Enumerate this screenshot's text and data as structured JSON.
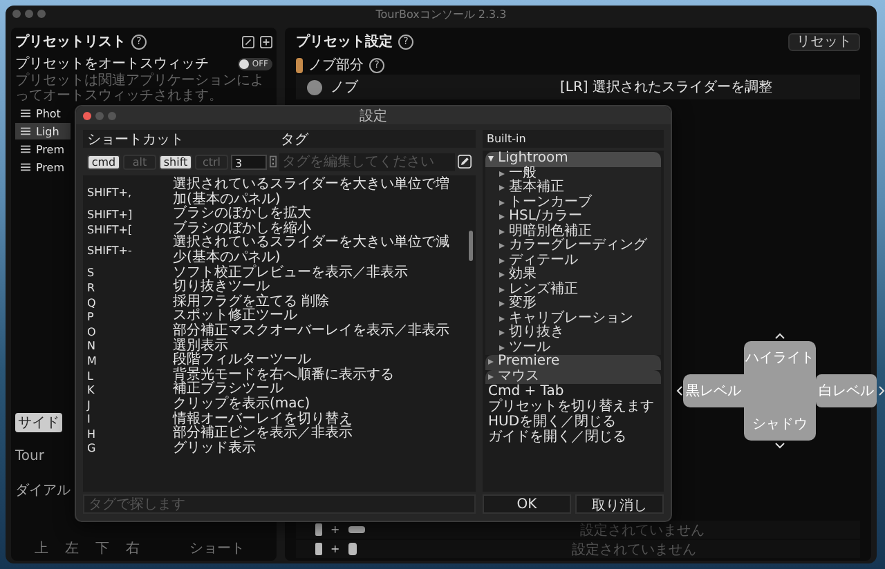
{
  "window": {
    "title": "TourBoxコンソール 2.3.3"
  },
  "preset_list": {
    "title": "プリセットリスト",
    "help": "?",
    "autoswitch": {
      "label": "プリセットをオートスウィッチ",
      "toggle": "OFF",
      "on": false
    },
    "description": "プリセットは関連アプリケーションによってオートスウィッチされます。",
    "items": [
      {
        "label": "Phot",
        "selected": false
      },
      {
        "label": "Ligh",
        "selected": true
      },
      {
        "label": "Prem",
        "selected": false
      },
      {
        "label": "Prem",
        "selected": false
      }
    ]
  },
  "controller": {
    "side_badge": "サイド",
    "labels": [
      "Tour",
      "ダイアル"
    ],
    "short_label": "ショート",
    "directions": [
      "上",
      "左",
      "下",
      "右"
    ]
  },
  "preset_settings": {
    "title": "プリセット設定",
    "help": "?",
    "reset": "リセット",
    "section": "ノブ部分",
    "section_help": "?",
    "knob": {
      "label": "ノブ",
      "action": "[LR] 選択されたスライダーを調整"
    },
    "rows": [
      {
        "kind": "plus_bar",
        "count": "+",
        "action": "設定されていません"
      },
      {
        "kind": "plus_tall",
        "count": "+",
        "action": "設定されていません"
      }
    ]
  },
  "dialog": {
    "title": "設定",
    "columns": [
      "ショートカット",
      "タグ"
    ],
    "modifiers": [
      {
        "label": "cmd",
        "selected": true
      },
      {
        "label": "alt",
        "selected": false
      },
      {
        "label": "shift",
        "selected": true
      },
      {
        "label": "ctrl",
        "selected": false
      }
    ],
    "key": "3",
    "tag_placeholder": "タグを編集してください",
    "shortcuts": [
      {
        "key": "SHIFT+,",
        "tag": "選択されているスライダーを大きい単位で増加(基本のパネル)"
      },
      {
        "key": "SHIFT+]",
        "tag": "ブラシのぼかしを拡大"
      },
      {
        "key": "SHIFT+[",
        "tag": "ブラシのぼかしを縮小"
      },
      {
        "key": "SHIFT+-",
        "tag": "選択されているスライダーを大きい単位で減少(基本のパネル)"
      },
      {
        "key": "S",
        "tag": "ソフト校正プレビューを表示／非表示"
      },
      {
        "key": "R",
        "tag": "切り抜きツール"
      },
      {
        "key": "Q",
        "tag": "採用フラグを立てる 削除"
      },
      {
        "key": "P",
        "tag": "スポット修正ツール"
      },
      {
        "key": "O",
        "tag": "部分補正マスクオーバーレイを表示／非表示"
      },
      {
        "key": "N",
        "tag": "選別表示"
      },
      {
        "key": "M",
        "tag": "段階フィルターツール"
      },
      {
        "key": "L",
        "tag": "背景光モードを右へ順番に表示する"
      },
      {
        "key": "K",
        "tag": "補正ブラシツール"
      },
      {
        "key": "J",
        "tag": "クリップを表示(mac)"
      },
      {
        "key": "I",
        "tag": "情報オーバーレイを切り替え"
      },
      {
        "key": "H",
        "tag": "部分補正ピンを表示／非表示"
      },
      {
        "key": "G",
        "tag": "グリッド表示"
      }
    ],
    "search_placeholder": "タグで探します",
    "builtin": {
      "title": "Built-in",
      "tree": [
        {
          "label": "Lightroom",
          "expanded": true,
          "selected": true,
          "children": [
            {
              "label": "一般",
              "expanded": false,
              "selected": false
            },
            {
              "label": "基本補正",
              "expanded": false,
              "selected": false
            },
            {
              "label": "トーンカーブ",
              "expanded": false,
              "selected": false
            },
            {
              "label": "HSL/カラー",
              "expanded": false,
              "selected": false
            },
            {
              "label": "明暗別色補正",
              "expanded": false,
              "selected": false
            },
            {
              "label": "カラーグレーディング",
              "expanded": false,
              "selected": false
            },
            {
              "label": "ディテール",
              "expanded": false,
              "selected": false
            },
            {
              "label": "効果",
              "expanded": false,
              "selected": false
            },
            {
              "label": "レンズ補正",
              "expanded": false,
              "selected": false
            },
            {
              "label": "変形",
              "expanded": false,
              "selected": false
            },
            {
              "label": "キャリブレーション",
              "expanded": false,
              "selected": false
            },
            {
              "label": "切り抜き",
              "expanded": false,
              "selected": false
            },
            {
              "label": "ツール",
              "expanded": false,
              "selected": false
            }
          ]
        },
        {
          "label": "Premiere",
          "expanded": false,
          "selected": false
        },
        {
          "label": "マウス",
          "expanded": false,
          "selected": false
        }
      ],
      "details": [
        "Cmd + Tab",
        "プリセットを切り替えます",
        "HUDを開く／閉じる",
        "ガイドを開く／閉じる"
      ]
    },
    "buttons": [
      "OK",
      "取り消し"
    ]
  },
  "hud": {
    "top": "ハイライト",
    "left": "黒レベル",
    "right": "白レベル",
    "bottom": "シャドウ"
  }
}
